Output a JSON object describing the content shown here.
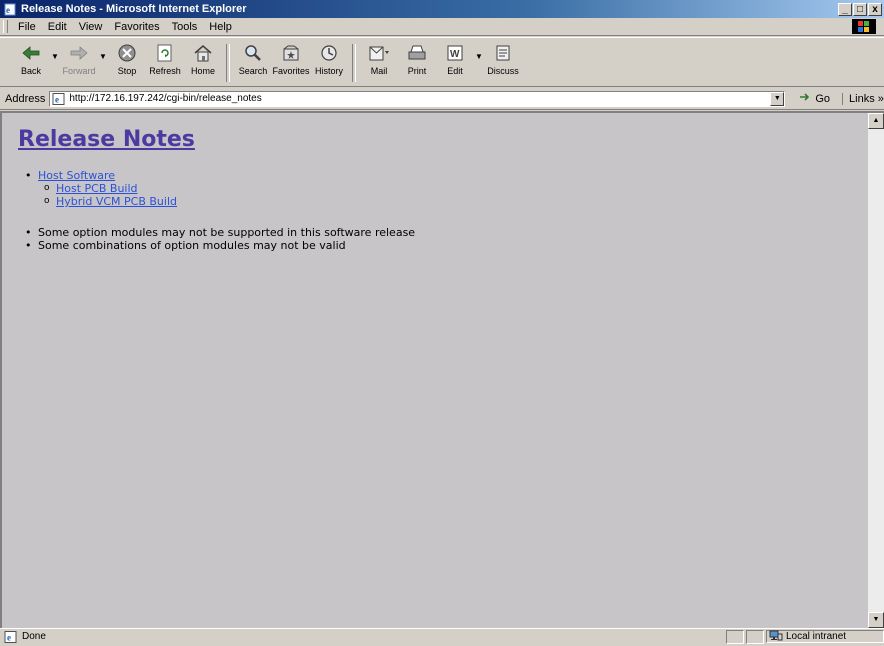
{
  "window": {
    "title": "Release Notes - Microsoft Internet Explorer",
    "controls": {
      "minimize": "_",
      "maximize": "□",
      "close": "x"
    }
  },
  "menu": {
    "items": [
      "File",
      "Edit",
      "View",
      "Favorites",
      "Tools",
      "Help"
    ]
  },
  "toolbar": {
    "buttons": [
      {
        "label": "Back",
        "icon": "back-arrow-icon"
      },
      {
        "label": "Forward",
        "icon": "forward-arrow-icon"
      },
      {
        "label": "Stop",
        "icon": "stop-icon"
      },
      {
        "label": "Refresh",
        "icon": "refresh-icon"
      },
      {
        "label": "Home",
        "icon": "home-icon"
      },
      {
        "label": "Search",
        "icon": "search-icon"
      },
      {
        "label": "Favorites",
        "icon": "favorites-icon"
      },
      {
        "label": "History",
        "icon": "history-icon"
      },
      {
        "label": "Mail",
        "icon": "mail-icon"
      },
      {
        "label": "Print",
        "icon": "print-icon"
      },
      {
        "label": "Edit",
        "icon": "edit-icon"
      },
      {
        "label": "Discuss",
        "icon": "discuss-icon"
      }
    ]
  },
  "address": {
    "label": "Address",
    "url": "http://172.16.197.242/cgi-bin/release_notes",
    "go_label": "Go",
    "links_label": "Links"
  },
  "page": {
    "heading": "Release Notes",
    "nav": {
      "top": "Host Software",
      "sub": [
        "Host PCB Build",
        "Hybrid VCM PCB Build"
      ]
    },
    "notes": [
      "Some option modules may not be supported in this software release",
      "Some combinations of option modules may not be valid"
    ]
  },
  "status": {
    "text": "Done",
    "zone": "Local intranet"
  },
  "colors": {
    "page_background": "#c8c5c8",
    "heading": "#4b3aa0",
    "link": "#2a52d8",
    "title_bar": "#0a246a"
  }
}
